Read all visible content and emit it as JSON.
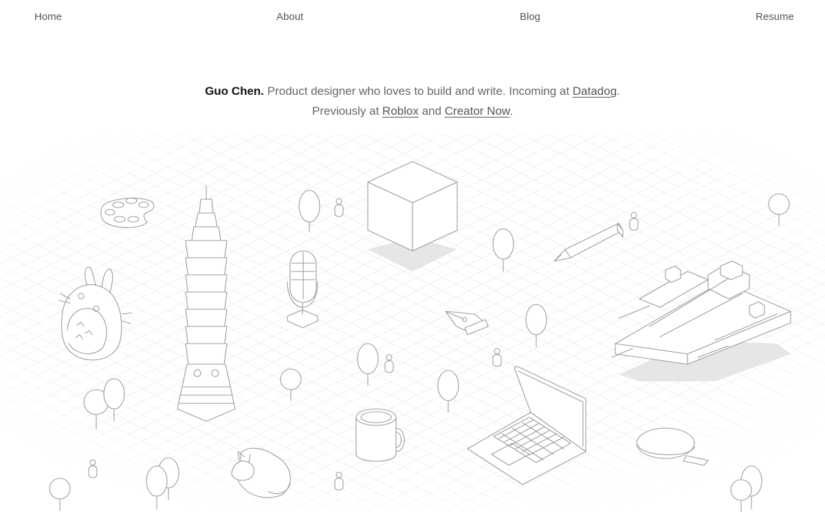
{
  "nav": {
    "home": "Home",
    "about": "About",
    "blog": "Blog",
    "resume": "Resume"
  },
  "intro": {
    "name": "Guo Chen.",
    "text1": " Product designer who loves to build and write. Incoming at ",
    "link_datadog": "Datadog",
    "period1": ".",
    "text2": "Previously at ",
    "link_roblox": "Roblox",
    "and": " and ",
    "link_creator": "Creator Now",
    "period2": "."
  },
  "scene_objects": [
    "paint-palette",
    "taipei-101-tower",
    "totoro",
    "microphone",
    "cube",
    "pencil",
    "fountain-pen-nib",
    "spaceship",
    "laptop",
    "mug",
    "sleeping-cat",
    "ping-pong-paddle",
    "trees",
    "people"
  ]
}
